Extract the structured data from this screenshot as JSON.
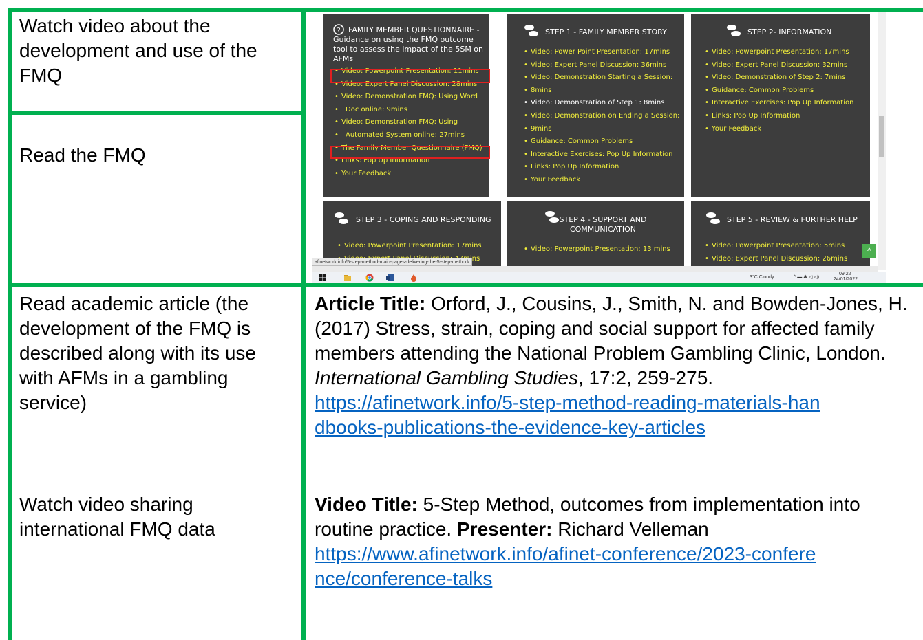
{
  "rows": [
    {
      "left": "Watch video about the development and use of the FMQ"
    },
    {
      "left": "Read the FMQ"
    },
    {
      "left": "Read academic article (the development of the FMQ is described along with its use with AFMs in a gambling service)",
      "right_label": "Article Title:",
      "right_text": " Orford, J., Cousins, J., Smith, N. and Bowden-Jones, H. (2017) Stress, strain, coping and social support for affected family members attending the National Problem Gambling Clinic, London. ",
      "right_italic": "International Gambling Studies",
      "right_text2": ", 17:2, 259-275.",
      "link": "https://afinetwork.info/5-step-method-reading-materials-handbooks-publications-the-evidence-key-articles"
    },
    {
      "left": "Watch video sharing international FMQ data",
      "right_label": "Video Title:",
      "right_text": " 5-Step Method, outcomes from implementation into routine practice. ",
      "right_label2": "Presenter:",
      "right_text2": " Richard Velleman",
      "link": "https://www.afinetwork.info/afinet-conference/2023-conference/conference-talks"
    }
  ],
  "screenshot": {
    "tiles": [
      {
        "title": "FAMILY MEMBER QUESTIONNAIRE - Guidance on using the FMQ outcome tool to assess the impact of the 5SM on AFMs",
        "items": [
          "Video: Powerpoint Presentation: 11mins",
          "Video: Expert Panel Discussion: 28mins",
          "Video: Demonstration FMQ: Using Word",
          "Doc online: 9mins",
          "Video: Demonstration FMQ: Using",
          "Automated System online: 27mins",
          "The Family Member Questionnaire (FMQ)",
          "Links: Pop Up Information",
          "Your Feedback"
        ]
      },
      {
        "title": "STEP 1 - FAMILY MEMBER STORY",
        "items": [
          "Video: Power Point Presentation: 17mins",
          "Video: Expert Panel Discussion: 36mins",
          "Video: Demonstration Starting a Session:",
          "8mins",
          "Video: Demonstration of Step 1: 8mins",
          "Video: Demonstration on Ending a Session:",
          "9mins",
          "Guidance: Common Problems",
          "Interactive Exercises: Pop Up Information",
          "Links: Pop Up Information",
          "Your Feedback"
        ]
      },
      {
        "title": "STEP 2- INFORMATION",
        "items": [
          "Video: Powerpoint Presentation: 17mins",
          "Video: Expert Panel Discussion: 32mins",
          "Video: Demonstration of Step 2: 7mins",
          "Guidance: Common Problems",
          "Interactive Exercises: Pop Up Information",
          "Links: Pop Up Information",
          "Your Feedback"
        ]
      },
      {
        "title": "STEP 3 - COPING AND RESPONDING",
        "items": [
          "Video: Powerpoint Presentation: 17mins",
          "Video: Expert Panel Discussion: 47mins"
        ]
      },
      {
        "title": "STEP 4 - SUPPORT AND COMMUNICATION",
        "items": [
          "Video: Powerpoint Presentation: 13 mins"
        ]
      },
      {
        "title": "STEP 5 - REVIEW & FURTHER HELP",
        "items": [
          "Video: Powerpoint Presentation: 5mins",
          "Video: Expert Panel Discussion: 26mins"
        ]
      }
    ],
    "status_url": "afinetwork.info/5-step-method-main-pages-delivering-the-5-step-method/",
    "tray": {
      "weather": "3°C  Cloudy",
      "time": "09:22",
      "date": "24/01/2022"
    },
    "up_arrow": "^",
    "colors": {
      "tile_bg": "#3d3d3d",
      "link_yellow": "#f2ef3b",
      "highlight": "#e02020"
    }
  },
  "colors": {
    "border": "#00b050",
    "link": "#0563c1"
  }
}
